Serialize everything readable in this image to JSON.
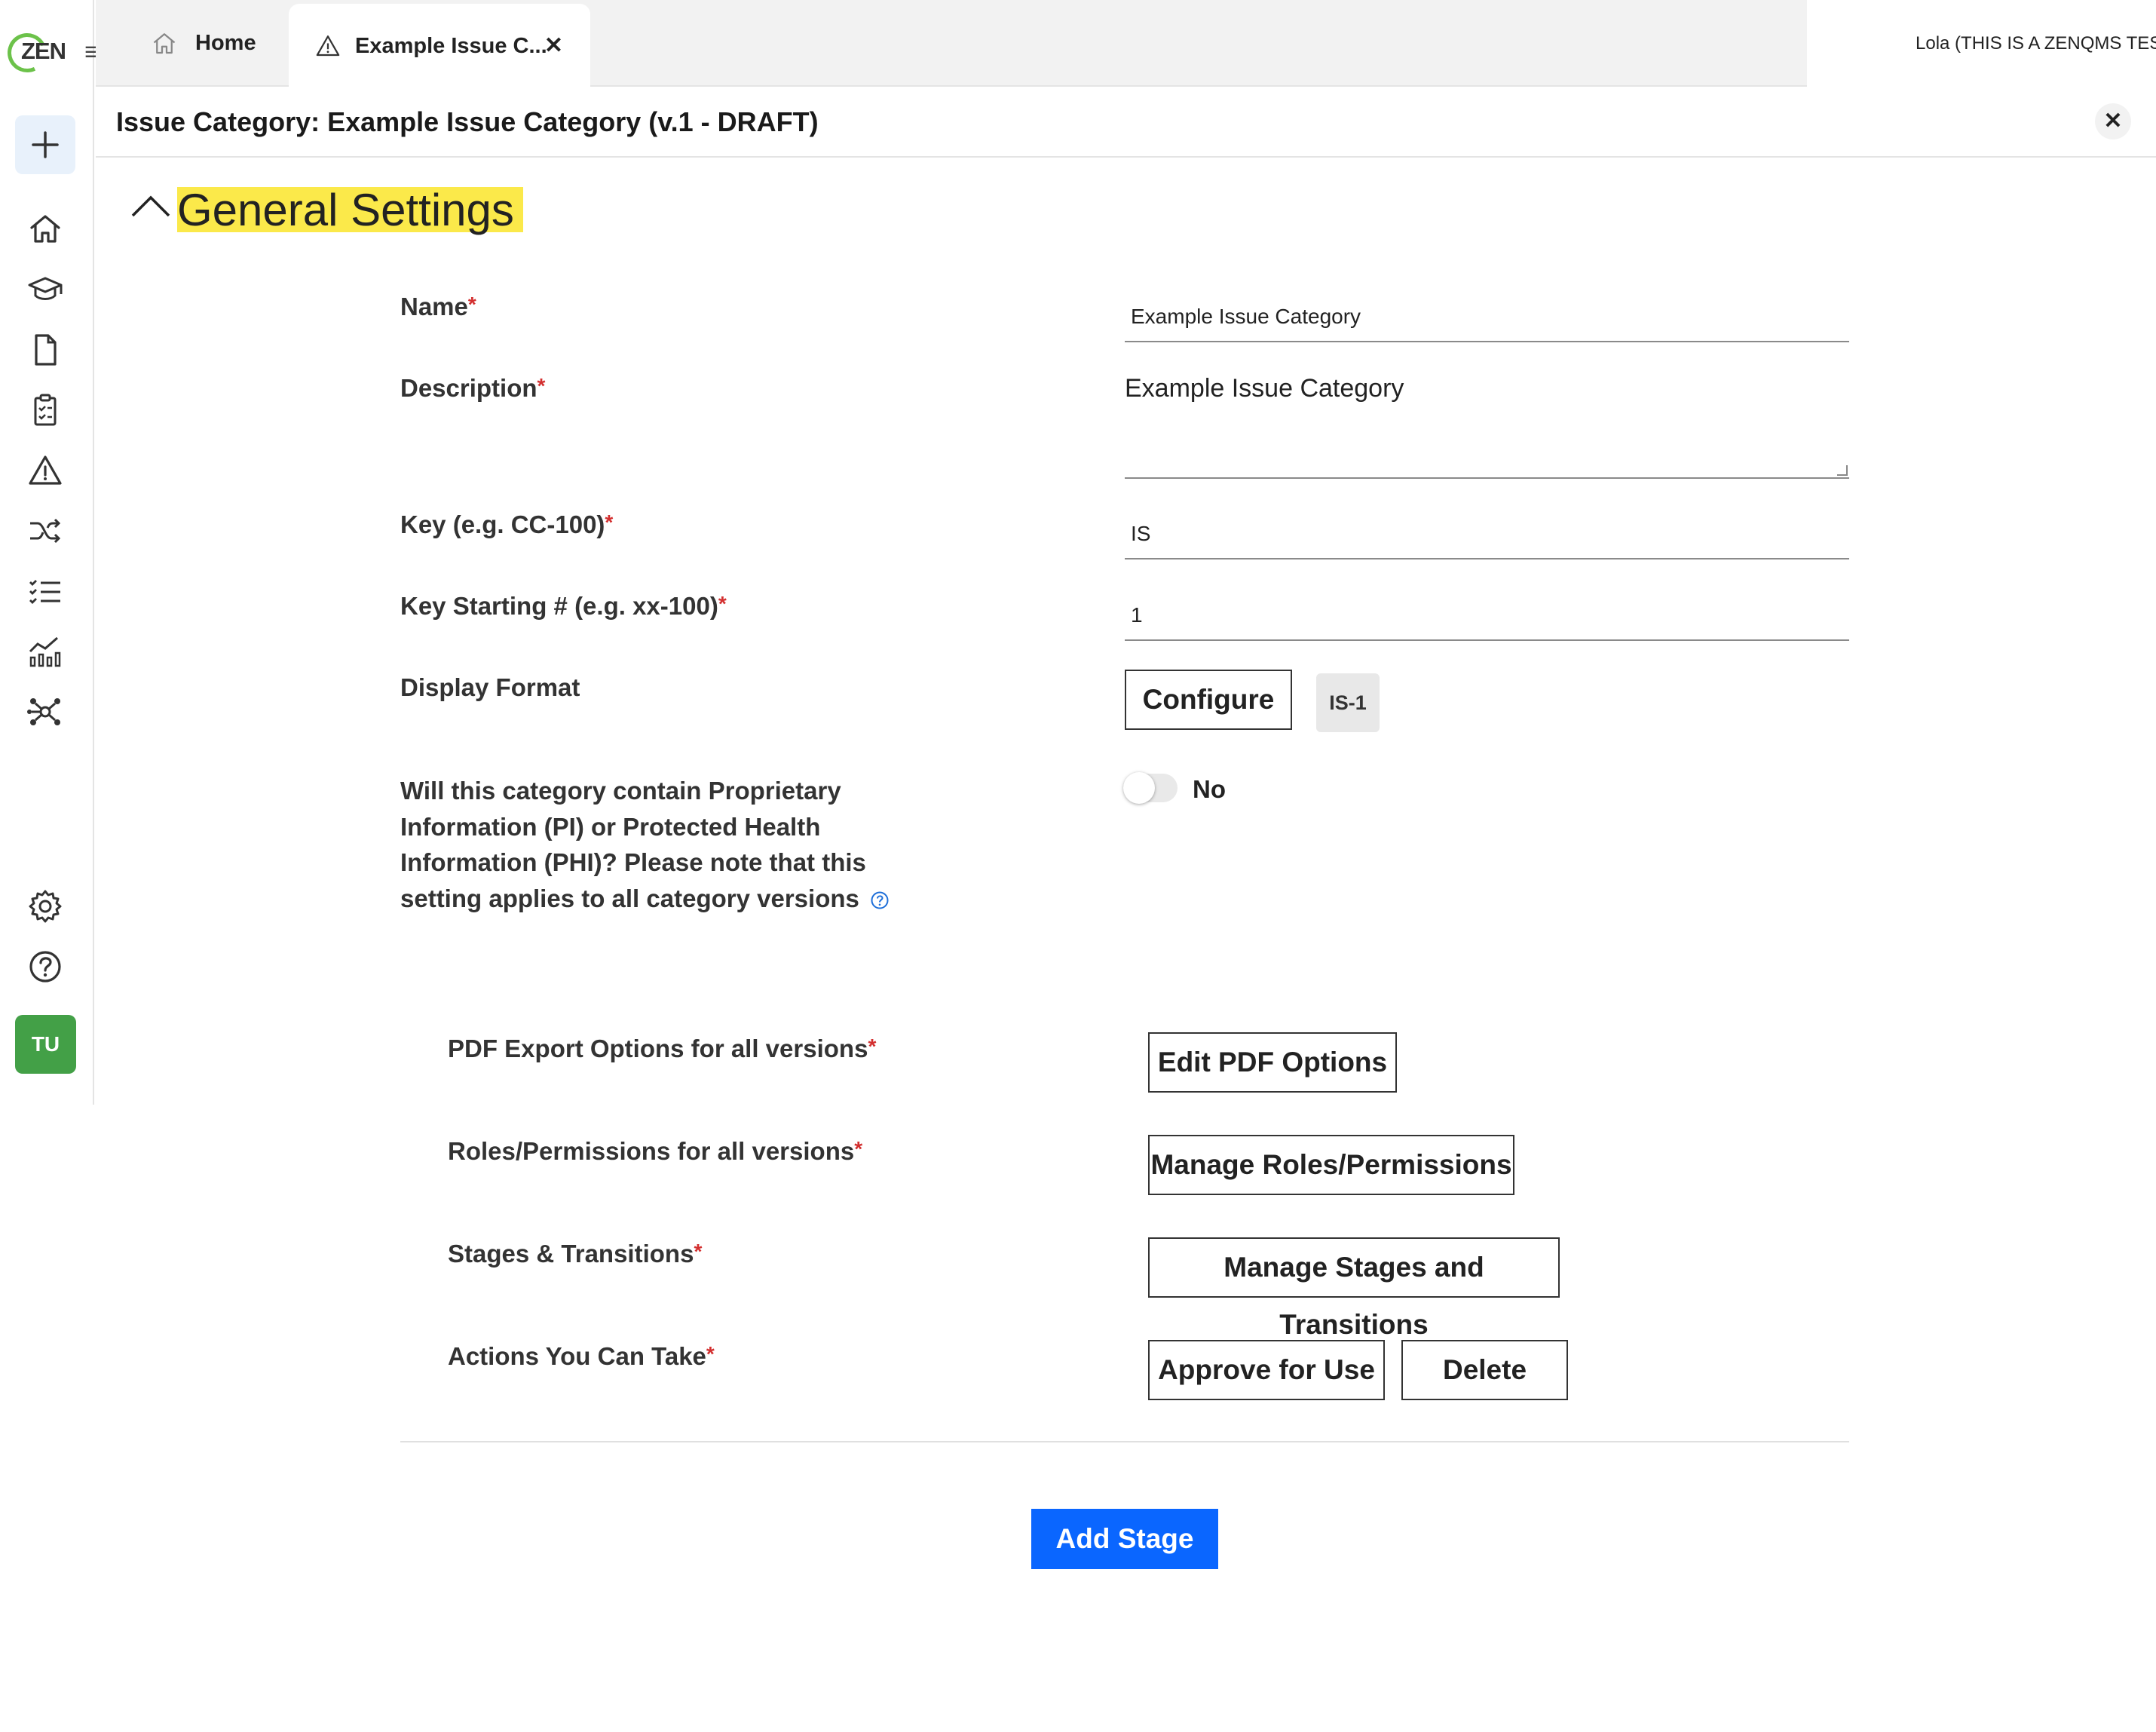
{
  "app": {
    "logo_text": "ZEN",
    "avatar_initials": "TU"
  },
  "tabs": [
    {
      "label": "Home"
    },
    {
      "label": "Example Issue C..."
    }
  ],
  "account": {
    "label": "Lola (THIS IS A ZENQMS TEST ACCOUNT)"
  },
  "header": {
    "title": "Issue Category: Example Issue Category (v.1 - DRAFT)"
  },
  "section": {
    "title": "General Settings"
  },
  "form": {
    "name_label": "Name",
    "name_value": "Example Issue Category",
    "description_label": "Description",
    "description_value": "Example Issue Category",
    "key_label": "Key (e.g. CC-100)",
    "key_value": "IS",
    "key_start_label": "Key Starting # (e.g. xx-100)",
    "key_start_value": "1",
    "display_format_label": "Display Format",
    "configure_label": "Configure",
    "format_preview": "IS-1",
    "pi_question": "Will this category contain Proprietary Information (PI) or Protected Health Information (PHI)? Please note that this setting applies to all category versions",
    "pi_toggle_label": "No",
    "required_marker": "*"
  },
  "options": {
    "pdf_label": "PDF Export Options for all versions",
    "pdf_button": "Edit PDF Options",
    "roles_label": "Roles/Permissions for all versions",
    "roles_button": "Manage Roles/Permissions",
    "stages_label": "Stages & Transitions",
    "stages_button": "Manage Stages and Transitions",
    "actions_label": "Actions You Can Take",
    "approve_button": "Approve for Use",
    "delete_button": "Delete"
  },
  "footer": {
    "add_stage_button": "Add Stage"
  },
  "nav_icons": [
    "plus-icon",
    "home-icon",
    "graduation-cap-icon",
    "document-icon",
    "clipboard-icon",
    "warning-icon",
    "shuffle-icon",
    "checklist-icon",
    "analytics-icon",
    "network-icon",
    "gear-icon",
    "help-icon"
  ],
  "colors": {
    "accent": "#0a66ff",
    "highlight": "#fbe94a",
    "avatar": "#43a047",
    "required": "#d32f2f"
  }
}
